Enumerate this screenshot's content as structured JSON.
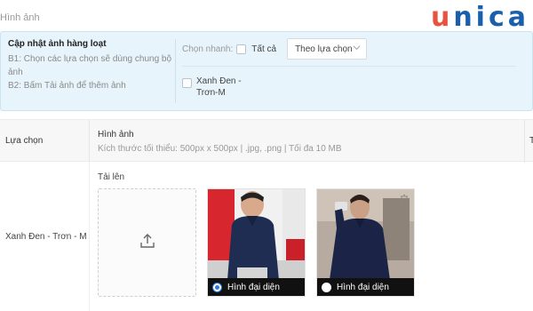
{
  "page": {
    "title": "Hình ảnh"
  },
  "brand": {
    "logo_u": "u",
    "logo_rest": "nica",
    "colors": {
      "accent_orange": "#e8533f",
      "accent_blue": "#1a5fab",
      "panel_bg": "#e7f4fb"
    }
  },
  "bulk_update": {
    "title": "Cập nhật ảnh hàng loạt",
    "step1": "B1: Chọn các lựa chọn sẽ dùng chung bộ ảnh",
    "step2": "B2: Bấm Tải ảnh để thêm ảnh",
    "quick_label": "Chọn nhanh:",
    "select_all_label": "Tất cả",
    "select_value": "Theo lựa chọn",
    "variant_label": "Xanh Đen - Trơn-M"
  },
  "table": {
    "col_choice": "Lựa chọn",
    "col_image": "Hình ảnh",
    "col_image_sub": "Kích thước tối thiểu: 500px x 500px | .jpg, .png | Tối đa 10 MB",
    "col_cut": "T"
  },
  "row": {
    "variant_name": "Xanh Đen - Trơn - M",
    "upload_label": "Tải lên",
    "upload_icon": "upload-icon",
    "images": [
      {
        "caption": "Hình đại diện",
        "selected": true
      },
      {
        "caption": "Hình đại diện",
        "selected": false
      }
    ]
  }
}
